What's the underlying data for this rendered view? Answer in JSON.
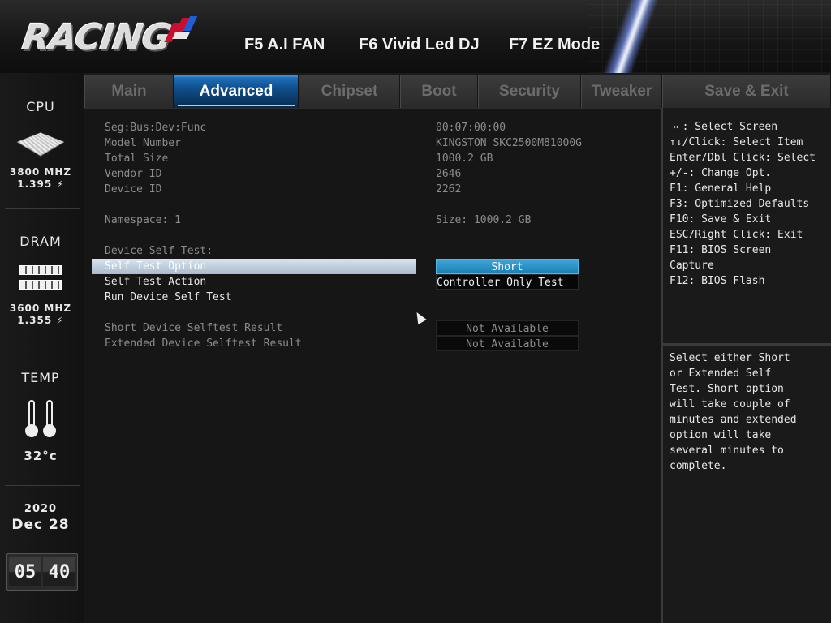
{
  "header": {
    "logo_text": "RACING",
    "hotkeys": {
      "fan": "F5 A.I FAN",
      "led": "F6 Vivid Led DJ",
      "ez": "F7 EZ Mode"
    }
  },
  "sidebar": {
    "cpu": {
      "title": "CPU",
      "freq": "3800 MHZ",
      "volt": "1.395 ⚡"
    },
    "dram": {
      "title": "DRAM",
      "freq": "3600 MHZ",
      "volt": "1.355 ⚡"
    },
    "temp": {
      "title": "TEMP",
      "value": "32°c"
    },
    "date": {
      "year": "2020",
      "month_day": "Dec 28"
    },
    "clock": {
      "hours": "05",
      "minutes": "40"
    }
  },
  "tabs": [
    {
      "label": "Main"
    },
    {
      "label": "Advanced"
    },
    {
      "label": "Chipset"
    },
    {
      "label": "Boot"
    },
    {
      "label": "Security"
    },
    {
      "label": "Tweaker"
    },
    {
      "label": "Save & Exit"
    }
  ],
  "active_tab": "Advanced",
  "main": {
    "seg_bus": {
      "label": "Seg:Bus:Dev:Func",
      "value": "00:07:00:00"
    },
    "model": {
      "label": "Model Number",
      "value": "KINGSTON SKC2500M81000G"
    },
    "total_size": {
      "label": "Total Size",
      "value": "1000.2 GB"
    },
    "vendor_id": {
      "label": "Vendor ID",
      "value": "2646"
    },
    "device_id": {
      "label": "Device ID",
      "value": "2262"
    },
    "namespace": {
      "label": "Namespace: 1",
      "value": "Size: 1000.2 GB"
    },
    "self_test_heading": "Device Self Test:",
    "self_test_option": {
      "label": "Self Test Option",
      "value": "Short"
    },
    "self_test_action": {
      "label": "Self Test Action",
      "value": "Controller Only Test"
    },
    "run_self_test": {
      "label": "Run Device Self Test"
    },
    "short_result": {
      "label": "Short Device Selftest Result",
      "value": "Not Available"
    },
    "extended_result": {
      "label": "Extended Device Selftest Result",
      "value": "Not Available"
    }
  },
  "help": {
    "keys": "→←: Select Screen\n↑↓/Click: Select Item\nEnter/Dbl Click: Select\n+/-: Change Opt.\nF1: General Help\nF3: Optimized Defaults\nF10: Save & Exit\nESC/Right Click: Exit\nF11: BIOS Screen\nCapture\nF12: BIOS Flash",
    "description": "Select either Short\nor Extended Self\nTest. Short option\nwill take couple of\nminutes and extended\noption will take\nseveral minutes to\ncomplete."
  },
  "colors": {
    "accent_blue": "#1b7fb3",
    "selected_row": "#a9bacb",
    "brand_red": "#c8102e"
  }
}
